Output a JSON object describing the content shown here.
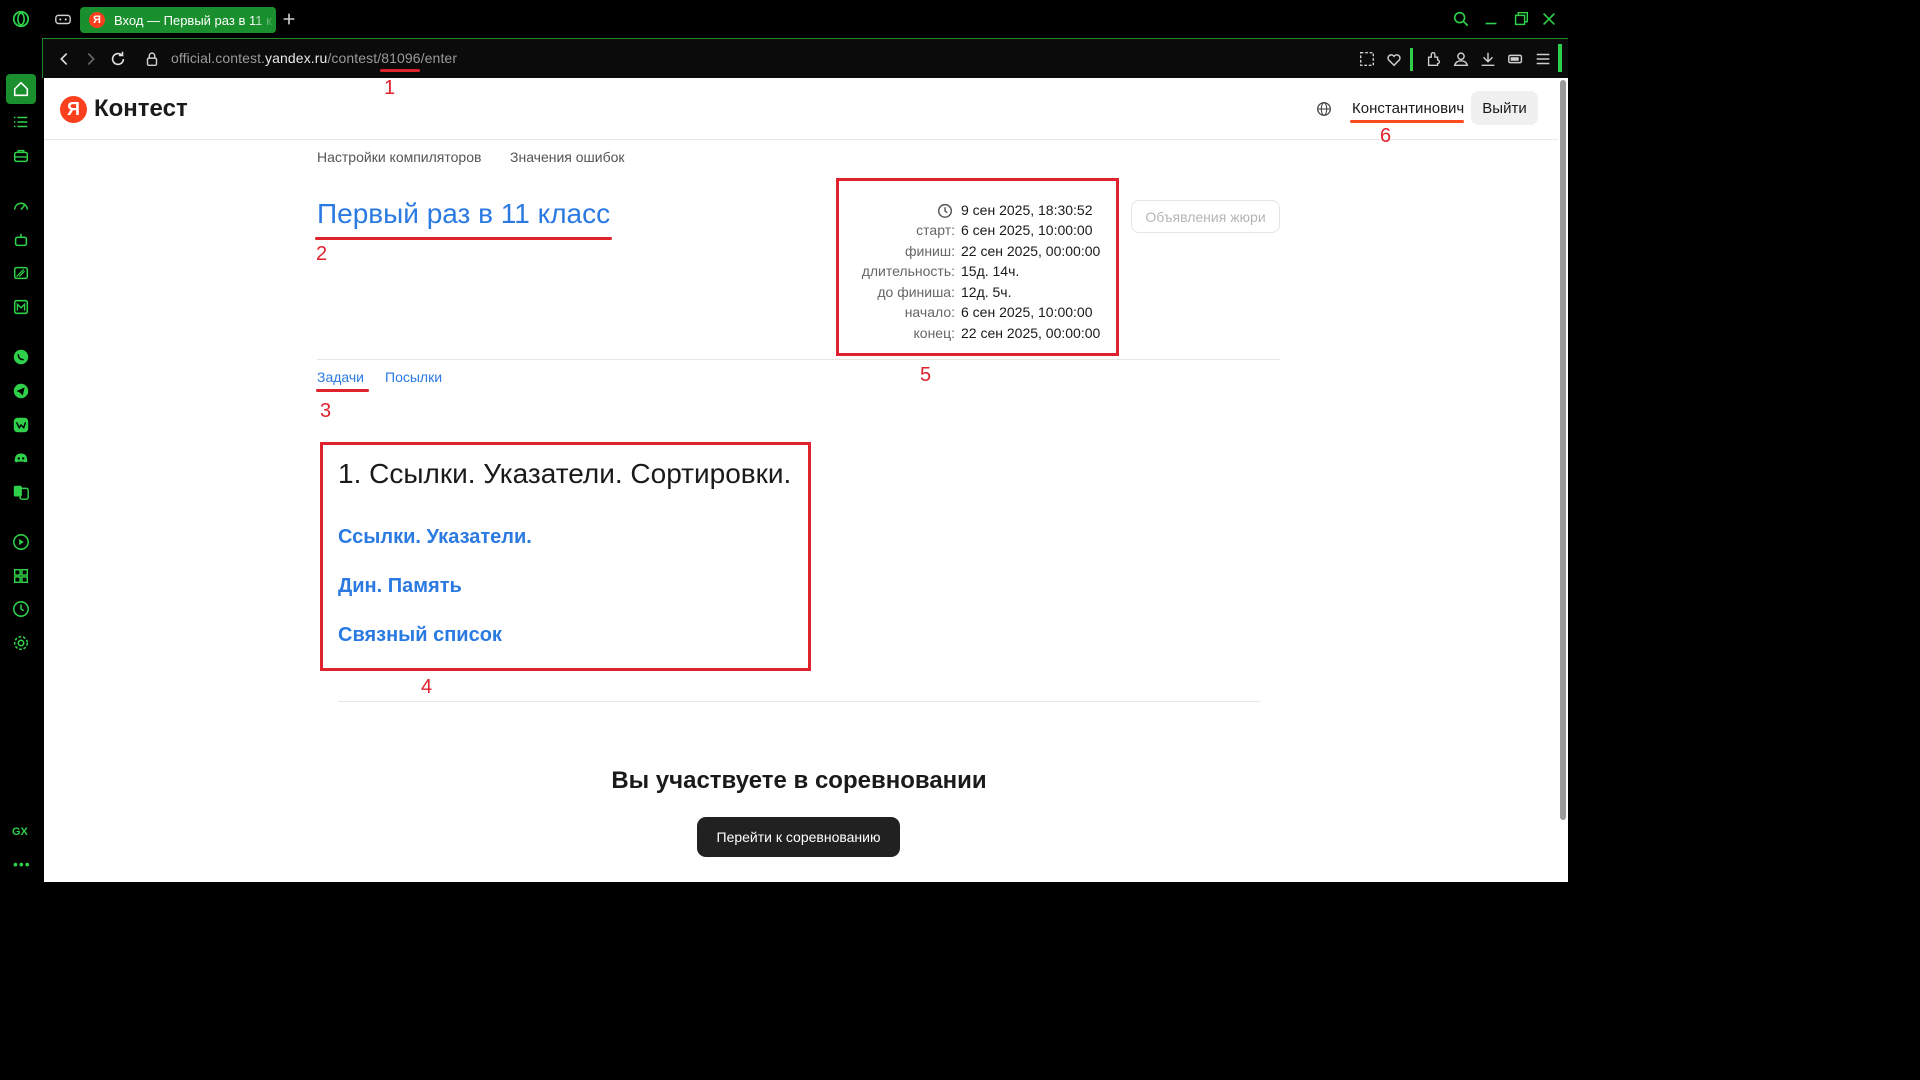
{
  "browser": {
    "tab_title": "Вход — Первый раз в 11 к",
    "url_prefix": "official.contest.",
    "url_domain": "yandex.ru",
    "url_suffix": "/contest/81096/enter"
  },
  "header": {
    "logo_letter": "Я",
    "logo_text": "Контест",
    "user_name": "Константинович",
    "logout_label": "Выйти"
  },
  "top_links": [
    "Настройки компиляторов",
    "Значения ошибок"
  ],
  "contest": {
    "title": "Первый раз в 11 класс",
    "jury_button": "Объявления жюри",
    "current_time": "9 сен 2025, 18:30:52",
    "info": [
      {
        "label": "старт:",
        "value": "6 сен 2025, 10:00:00"
      },
      {
        "label": "финиш:",
        "value": "22 сен 2025, 00:00:00"
      },
      {
        "label": "длительность:",
        "value": "15д. 14ч."
      },
      {
        "label": "до финиша:",
        "value": "12д. 5ч."
      },
      {
        "label": "начало:",
        "value": "6 сен 2025, 10:00:00"
      },
      {
        "label": "конец:",
        "value": "22 сен 2025, 00:00:00"
      }
    ]
  },
  "tabs": [
    "Задачи",
    "Посылки"
  ],
  "section_title": "1. Ссылки. Указатели. Сортировки.",
  "problems": [
    "Ссылки. Указатели.",
    "Дин. Память",
    "Связный список"
  ],
  "participate_text": "Вы участвуете в соревновании",
  "go_button": "Перейти к соревнованию",
  "annotations": [
    "1",
    "2",
    "3",
    "4",
    "5",
    "6"
  ],
  "sidebar_bottom": "GX",
  "colors": {
    "accent": "#2a7ae2",
    "browser_green": "#2fd14a",
    "annotation_red": "#e0212e"
  }
}
